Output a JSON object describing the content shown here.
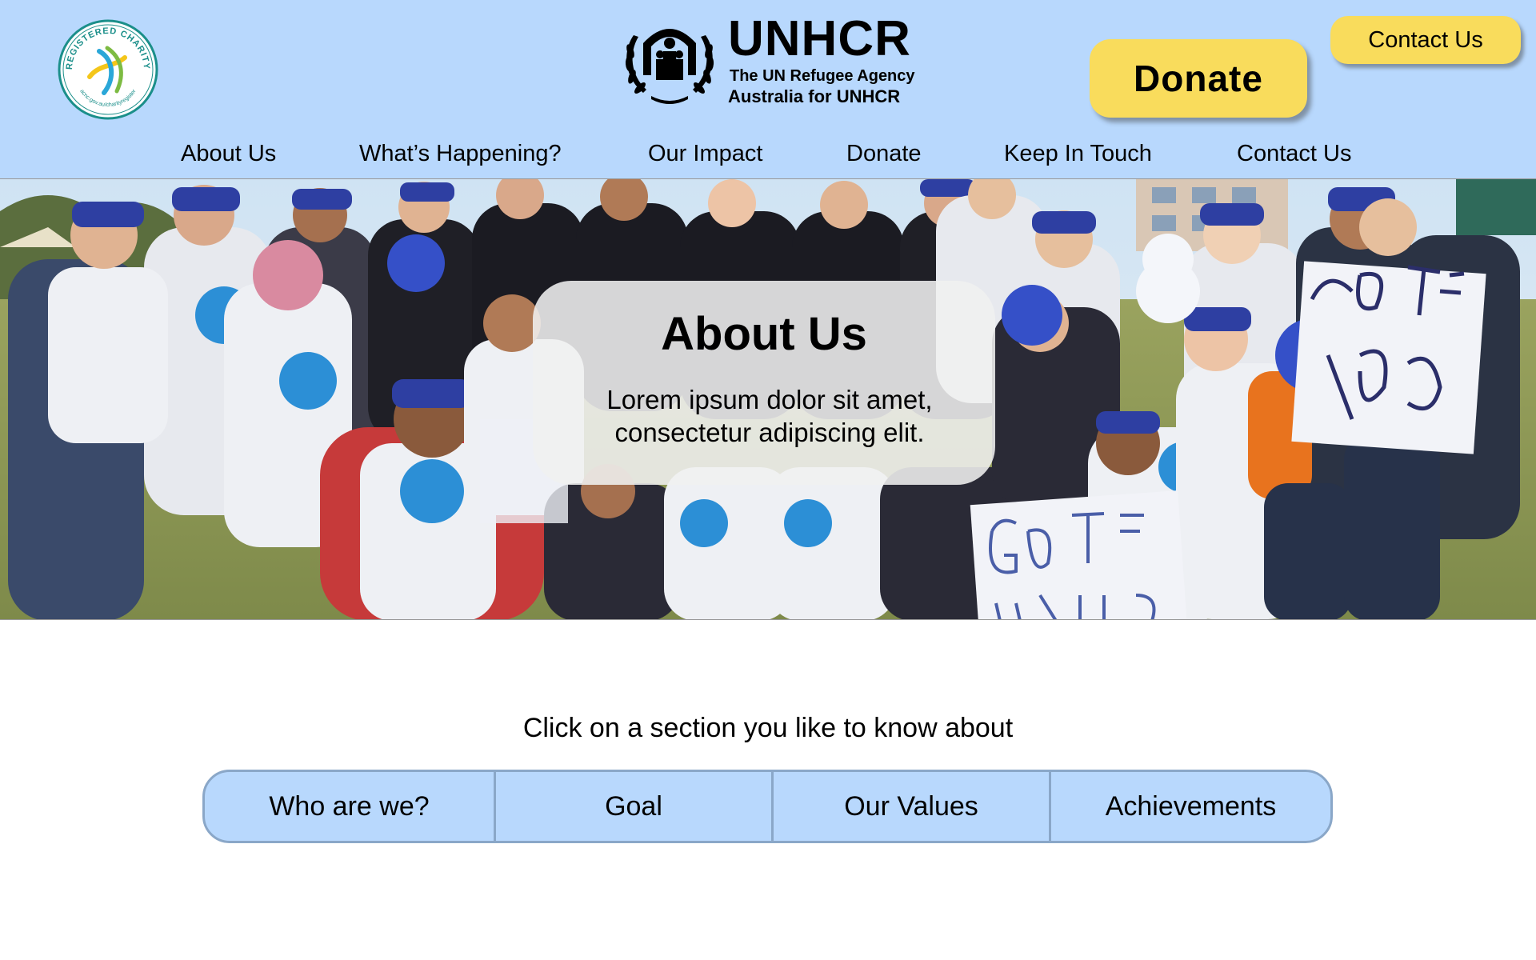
{
  "header": {
    "brand": {
      "wordmark": "UNHCR",
      "tagline": "The UN Refugee Agency",
      "subtagline": "Australia for UNHCR"
    },
    "charity_badge": {
      "text": "REGISTERED CHARITY",
      "url_text": "acnc.gov.au/charityregister"
    },
    "donate_button": "Donate",
    "contact_button": "Contact Us",
    "nav": [
      {
        "label": "About Us"
      },
      {
        "label": "What’s Happening?"
      },
      {
        "label": "Our Impact"
      },
      {
        "label": "Donate"
      },
      {
        "label": "Keep In Touch"
      },
      {
        "label": "Contact Us"
      }
    ]
  },
  "hero": {
    "title": "About Us",
    "text": "Lorem ipsum dolor sit amet, consectetur adipiscing elit."
  },
  "sections": {
    "prompt": "Click on a section you like to know about",
    "tabs": [
      {
        "label": "Who are we?"
      },
      {
        "label": "Goal"
      },
      {
        "label": "Our Values"
      },
      {
        "label": "Achievements"
      }
    ]
  },
  "colors": {
    "header_bg": "#b8d8fd",
    "button_yellow": "#f9dc5c",
    "tab_border": "#8aa7c8"
  }
}
